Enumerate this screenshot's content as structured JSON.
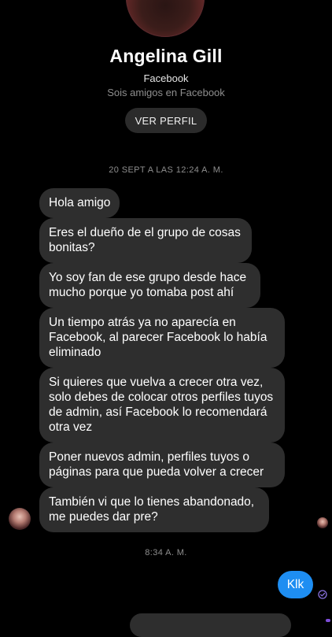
{
  "profile": {
    "name": "Angelina Gill",
    "source": "Facebook",
    "friendship": "Sois amigos en Facebook",
    "view_profile_label": "VER PERFIL"
  },
  "timestamps": {
    "first": "20 SEPT A LAS 12:24 A. M.",
    "second": "8:34 A. M."
  },
  "incoming_messages": [
    "Hola amigo",
    "Eres el dueño de el grupo de cosas bonitas?",
    "Yo soy fan de ese grupo desde hace mucho porque yo tomaba post ahí",
    "Un tiempo atrás ya no aparecía en Facebook, al parecer Facebook lo había eliminado",
    "Si quieres que vuelva a crecer otra vez, solo debes de colocar otros perfiles tuyos de admin, así Facebook lo recomendará otra vez",
    "Poner nuevos admin, perfiles tuyos o páginas para que pueda volver a crecer",
    "También vi que lo tienes abandonado, me puedes dar pre?"
  ],
  "outgoing_messages": [
    "Klk"
  ],
  "colors": {
    "background": "#000000",
    "incoming_bubble": "#2e2e2e",
    "outgoing_bubble": "#1e8ef2",
    "muted_text": "#8e8e8e"
  },
  "icons": {
    "delivered": "check-circle-icon"
  }
}
